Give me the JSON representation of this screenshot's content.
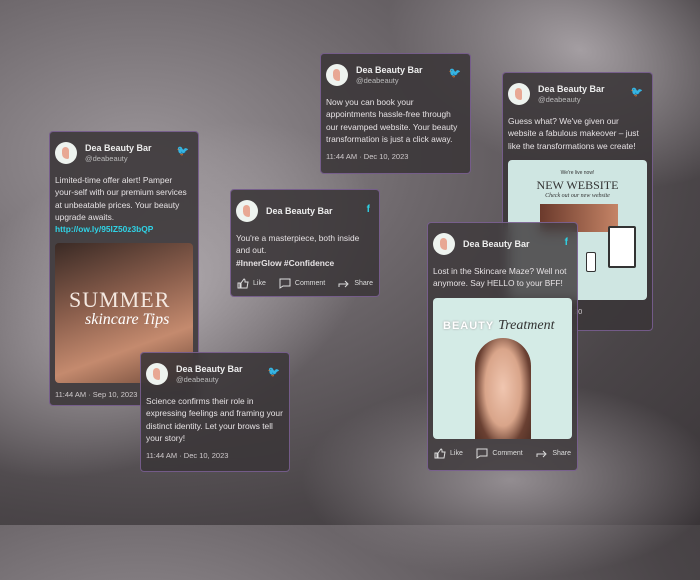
{
  "brand": {
    "name": "Dea Beauty Bar",
    "handle": "@deabeauty",
    "accent": "#2fd3e6"
  },
  "posts": [
    {
      "network": "twitter-icon",
      "text": "Limited-time offer alert! Pamper your-self with our premium services at unbeatable prices. Your beauty upgrade awaits.",
      "link": "http://ow.ly/95lZ50z3bQP",
      "timestamp": "11:44 AM · Sep 10, 2023",
      "image": {
        "title": "SUMMER",
        "subtitle": "skincare Tips"
      }
    },
    {
      "network": "facebook-icon",
      "text": "You're a masterpiece, both inside and out.",
      "hashtags": "#InnerGlow #Confidence",
      "actions": [
        "Like",
        "Comment",
        "Share"
      ]
    },
    {
      "network": "twitter-icon",
      "text": "Now you can book your appointments hassle-free through our revamped website. Your beauty transformation is just a click away.",
      "timestamp": "11:44 AM · Dec 10, 2023"
    },
    {
      "network": "twitter-icon",
      "text": "Guess what? We've given our website a fabulous makeover – just like the transformations we create!",
      "timestamp_visible": "20",
      "image": {
        "kicker": "We're live now!",
        "title": "NEW WEBSITE",
        "subtitle": "Check out our new website"
      }
    },
    {
      "network": "facebook-icon",
      "text": "Lost in the Skincare Maze? Well not anymore. Say HELLO to your BFF!",
      "image": {
        "title": "BEAUTY",
        "subtitle": "Treatment"
      },
      "actions": [
        "Like",
        "Comment",
        "Share"
      ]
    },
    {
      "network": "twitter-icon",
      "text": "Science confirms their role in expressing feelings and framing your distinct identity. Let your brows tell your story!",
      "timestamp": "11:44 AM · Dec 10, 2023"
    }
  ]
}
